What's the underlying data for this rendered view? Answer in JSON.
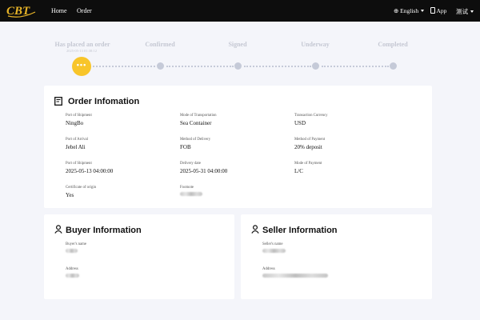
{
  "nav": {
    "logo_text": "CBT",
    "home": "Home",
    "order": "Order",
    "language": "English",
    "app": "App",
    "user": "测试"
  },
  "progress": {
    "steps": [
      {
        "label": "Has placed an order",
        "date": "2025-05-13 01:38:12",
        "state": "current"
      },
      {
        "label": "Confirmed",
        "state": "pending"
      },
      {
        "label": "Signed",
        "state": "pending"
      },
      {
        "label": "Underway",
        "state": "pending"
      },
      {
        "label": "Completed",
        "state": "pending"
      }
    ],
    "current_glyph": "•••"
  },
  "order_info": {
    "title": "Order Infomation",
    "fields": [
      {
        "label": "Port of Shipment",
        "value": "NingBo"
      },
      {
        "label": "Mode of Transportation",
        "value": "Sea Container"
      },
      {
        "label": "Transaction Currency",
        "value": "USD"
      },
      {
        "label": "Port of Arrival",
        "value": "Jebel Ali"
      },
      {
        "label": "Method of Delivery",
        "value": "FOB"
      },
      {
        "label": "Method of Payment",
        "value": "20% deposit"
      },
      {
        "label": "Port of Shipment",
        "value": "2025-05-13 04:00:00"
      },
      {
        "label": "Delivery date",
        "value": "2025-05-31 04:00:00"
      },
      {
        "label": "Mode of Payment",
        "value": "L/C"
      },
      {
        "label": "Certificate of origin",
        "value": "Yes"
      },
      {
        "label": "Footnote",
        "value": ""
      }
    ]
  },
  "buyer": {
    "title": "Buyer Information",
    "name_label": "Buyer's name",
    "address_label": "Address"
  },
  "seller": {
    "title": "Seller Information",
    "name_label": "Seller's name",
    "address_label": "Address"
  },
  "colors": {
    "topbar": "#0d0d0d",
    "accent": "#f8c52a",
    "inactive": "#c5cad8",
    "page_bg": "#f4f5fa"
  }
}
